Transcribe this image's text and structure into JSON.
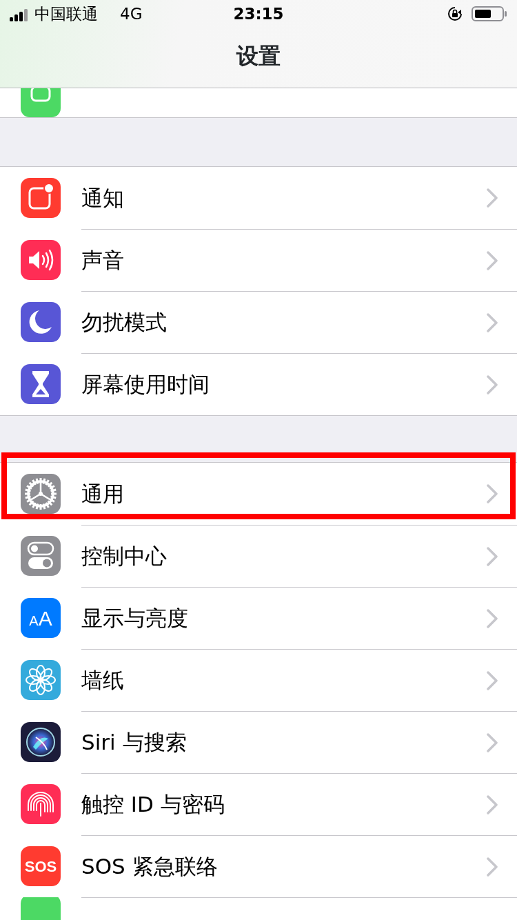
{
  "status_bar": {
    "carrier": "中国联通",
    "network": "4G",
    "time": "23:15"
  },
  "nav_title": "设置",
  "groups": [
    {
      "rows": [
        {
          "kind": "hotspot",
          "color": "#4cd964",
          "clipped_top": true
        }
      ]
    },
    {
      "rows": [
        {
          "kind": "notifications",
          "color": "#ff3b30",
          "label": "通知"
        },
        {
          "kind": "sounds",
          "color": "#ff2d55",
          "label": "声音"
        },
        {
          "kind": "moon",
          "color": "#5856d6",
          "label": "勿扰模式"
        },
        {
          "kind": "hourglass",
          "color": "#5856d6",
          "label": "屏幕使用时间"
        }
      ]
    },
    {
      "rows": [
        {
          "kind": "gear",
          "color": "#8e8e93",
          "label": "通用",
          "highlighted": true
        },
        {
          "kind": "toggles",
          "color": "#8e8e93",
          "label": "控制中心",
          "highlighted": false
        },
        {
          "kind": "text",
          "color": "#007aff",
          "label": "显示与亮度",
          "icon_text": "AA",
          "highlighted": false
        },
        {
          "kind": "flower",
          "color": "#34aadc",
          "label": "墙纸",
          "highlighted": false
        },
        {
          "kind": "siri",
          "color": "#1c1c3a",
          "label": "Siri 与搜索",
          "highlighted": false
        },
        {
          "kind": "fingerprint",
          "color": "#ff2d55",
          "label": "触控 ID 与密码",
          "highlighted": false
        },
        {
          "kind": "text",
          "color": "#ff3b30",
          "label": "SOS 紧急联络",
          "icon_text": "SOS",
          "highlighted": false
        },
        {
          "kind": "battery",
          "color": "#4cd964",
          "clipped_bottom": true
        }
      ]
    }
  ]
}
